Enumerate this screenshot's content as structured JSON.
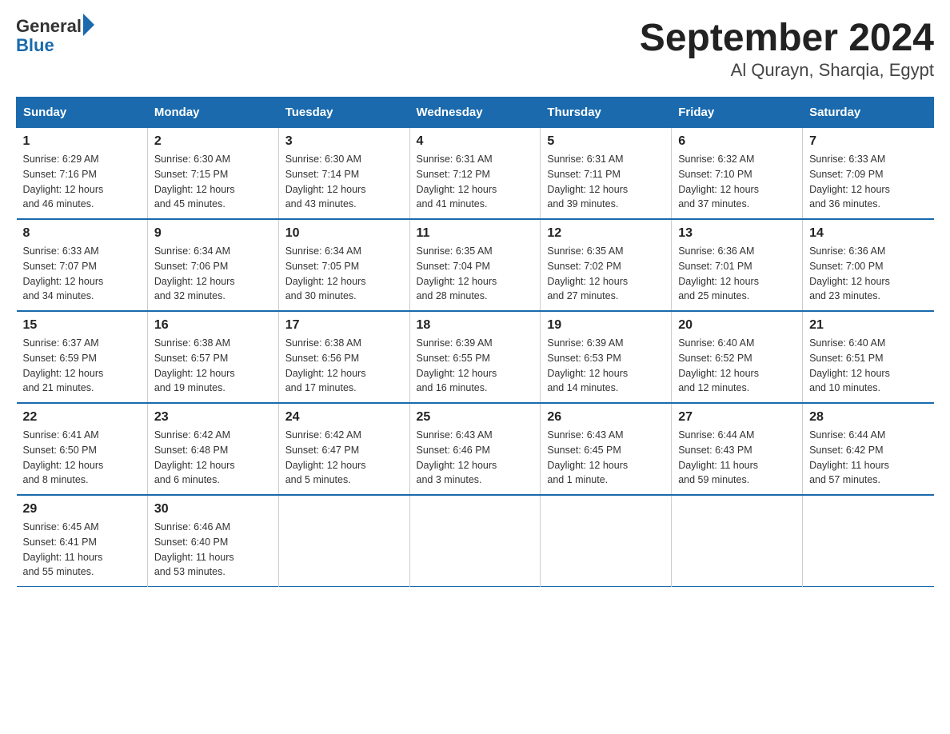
{
  "header": {
    "logo_general": "General",
    "logo_blue": "Blue",
    "title": "September 2024",
    "subtitle": "Al Qurayn, Sharqia, Egypt"
  },
  "weekdays": [
    "Sunday",
    "Monday",
    "Tuesday",
    "Wednesday",
    "Thursday",
    "Friday",
    "Saturday"
  ],
  "weeks": [
    [
      {
        "day": "1",
        "sunrise": "6:29 AM",
        "sunset": "7:16 PM",
        "daylight": "12 hours and 46 minutes."
      },
      {
        "day": "2",
        "sunrise": "6:30 AM",
        "sunset": "7:15 PM",
        "daylight": "12 hours and 45 minutes."
      },
      {
        "day": "3",
        "sunrise": "6:30 AM",
        "sunset": "7:14 PM",
        "daylight": "12 hours and 43 minutes."
      },
      {
        "day": "4",
        "sunrise": "6:31 AM",
        "sunset": "7:12 PM",
        "daylight": "12 hours and 41 minutes."
      },
      {
        "day": "5",
        "sunrise": "6:31 AM",
        "sunset": "7:11 PM",
        "daylight": "12 hours and 39 minutes."
      },
      {
        "day": "6",
        "sunrise": "6:32 AM",
        "sunset": "7:10 PM",
        "daylight": "12 hours and 37 minutes."
      },
      {
        "day": "7",
        "sunrise": "6:33 AM",
        "sunset": "7:09 PM",
        "daylight": "12 hours and 36 minutes."
      }
    ],
    [
      {
        "day": "8",
        "sunrise": "6:33 AM",
        "sunset": "7:07 PM",
        "daylight": "12 hours and 34 minutes."
      },
      {
        "day": "9",
        "sunrise": "6:34 AM",
        "sunset": "7:06 PM",
        "daylight": "12 hours and 32 minutes."
      },
      {
        "day": "10",
        "sunrise": "6:34 AM",
        "sunset": "7:05 PM",
        "daylight": "12 hours and 30 minutes."
      },
      {
        "day": "11",
        "sunrise": "6:35 AM",
        "sunset": "7:04 PM",
        "daylight": "12 hours and 28 minutes."
      },
      {
        "day": "12",
        "sunrise": "6:35 AM",
        "sunset": "7:02 PM",
        "daylight": "12 hours and 27 minutes."
      },
      {
        "day": "13",
        "sunrise": "6:36 AM",
        "sunset": "7:01 PM",
        "daylight": "12 hours and 25 minutes."
      },
      {
        "day": "14",
        "sunrise": "6:36 AM",
        "sunset": "7:00 PM",
        "daylight": "12 hours and 23 minutes."
      }
    ],
    [
      {
        "day": "15",
        "sunrise": "6:37 AM",
        "sunset": "6:59 PM",
        "daylight": "12 hours and 21 minutes."
      },
      {
        "day": "16",
        "sunrise": "6:38 AM",
        "sunset": "6:57 PM",
        "daylight": "12 hours and 19 minutes."
      },
      {
        "day": "17",
        "sunrise": "6:38 AM",
        "sunset": "6:56 PM",
        "daylight": "12 hours and 17 minutes."
      },
      {
        "day": "18",
        "sunrise": "6:39 AM",
        "sunset": "6:55 PM",
        "daylight": "12 hours and 16 minutes."
      },
      {
        "day": "19",
        "sunrise": "6:39 AM",
        "sunset": "6:53 PM",
        "daylight": "12 hours and 14 minutes."
      },
      {
        "day": "20",
        "sunrise": "6:40 AM",
        "sunset": "6:52 PM",
        "daylight": "12 hours and 12 minutes."
      },
      {
        "day": "21",
        "sunrise": "6:40 AM",
        "sunset": "6:51 PM",
        "daylight": "12 hours and 10 minutes."
      }
    ],
    [
      {
        "day": "22",
        "sunrise": "6:41 AM",
        "sunset": "6:50 PM",
        "daylight": "12 hours and 8 minutes."
      },
      {
        "day": "23",
        "sunrise": "6:42 AM",
        "sunset": "6:48 PM",
        "daylight": "12 hours and 6 minutes."
      },
      {
        "day": "24",
        "sunrise": "6:42 AM",
        "sunset": "6:47 PM",
        "daylight": "12 hours and 5 minutes."
      },
      {
        "day": "25",
        "sunrise": "6:43 AM",
        "sunset": "6:46 PM",
        "daylight": "12 hours and 3 minutes."
      },
      {
        "day": "26",
        "sunrise": "6:43 AM",
        "sunset": "6:45 PM",
        "daylight": "12 hours and 1 minute."
      },
      {
        "day": "27",
        "sunrise": "6:44 AM",
        "sunset": "6:43 PM",
        "daylight": "11 hours and 59 minutes."
      },
      {
        "day": "28",
        "sunrise": "6:44 AM",
        "sunset": "6:42 PM",
        "daylight": "11 hours and 57 minutes."
      }
    ],
    [
      {
        "day": "29",
        "sunrise": "6:45 AM",
        "sunset": "6:41 PM",
        "daylight": "11 hours and 55 minutes."
      },
      {
        "day": "30",
        "sunrise": "6:46 AM",
        "sunset": "6:40 PM",
        "daylight": "11 hours and 53 minutes."
      },
      null,
      null,
      null,
      null,
      null
    ]
  ],
  "labels": {
    "sunrise": "Sunrise:",
    "sunset": "Sunset:",
    "daylight": "Daylight:"
  }
}
